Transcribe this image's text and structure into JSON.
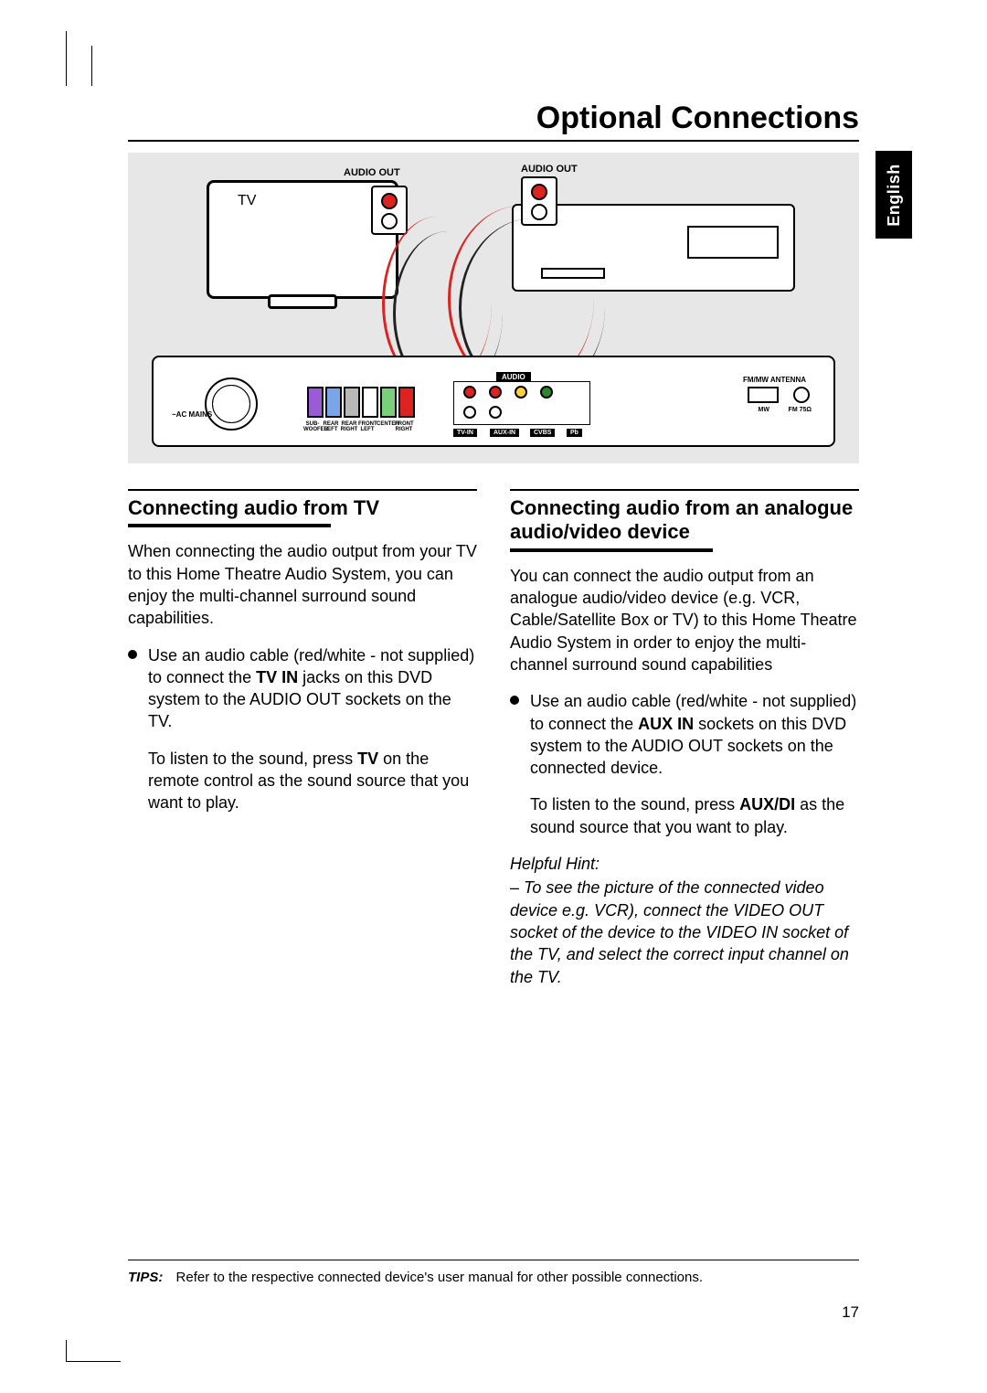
{
  "page_title": "Optional Connections",
  "language_tab": "English",
  "page_number": "17",
  "diagram": {
    "tv_label": "TV",
    "audio_out_1": "AUDIO OUT",
    "audio_out_2": "AUDIO OUT",
    "panel": {
      "ac_mains": "~AC MAINS",
      "audio_label": "AUDIO",
      "tv_in": "TV-IN",
      "aux_in": "AUX-IN",
      "cvbs": "CVBS",
      "pb": "Pb",
      "antenna": "FM/MW ANTENNA",
      "mw": "MW",
      "fm": "FM 75Ω",
      "speakers": {
        "sub": "SUB-WOOFER",
        "rl": "REAR LEFT",
        "rr": "REAR RIGHT",
        "fl": "FRONT LEFT",
        "c": "CENTER",
        "fr": "FRONT RIGHT"
      }
    }
  },
  "left": {
    "heading": "Connecting audio from TV",
    "p1": "When connecting the audio output from your TV to this Home Theatre Audio System, you can enjoy the multi-channel surround sound capabilities.",
    "b1_a": "Use an audio cable (red/white - not supplied) to connect the ",
    "b1_bold": "TV IN",
    "b1_b": " jacks on this DVD system to the AUDIO OUT sockets on the TV.",
    "p2_a": "To listen to the sound, press ",
    "p2_bold": "TV",
    "p2_b": " on the remote control as the sound source that you want to play."
  },
  "right": {
    "heading": "Connecting audio from an analogue audio/video device",
    "p1": "You can connect the audio output from an analogue audio/video device (e.g. VCR, Cable/Satellite Box or TV) to this Home Theatre Audio System in order to enjoy the multi-channel surround sound capabilities",
    "b1_a": "Use an audio cable (red/white - not supplied) to connect the ",
    "b1_bold": "AUX IN",
    "b1_b": " sockets on this DVD system to the AUDIO OUT sockets on the connected device.",
    "p2_a": "To listen to the sound, press ",
    "p2_bold": "AUX/DI",
    "p2_b": " as the sound source that you want to play.",
    "hint_label": "Helpful Hint:",
    "hint_body": "– To see the picture of the connected video device e.g. VCR), connect the VIDEO OUT socket of the device to the VIDEO IN socket of the TV, and select the correct input channel on the TV."
  },
  "tips": {
    "label": "TIPS:",
    "body": "Refer to the respective connected device's user manual for other possible connections."
  }
}
